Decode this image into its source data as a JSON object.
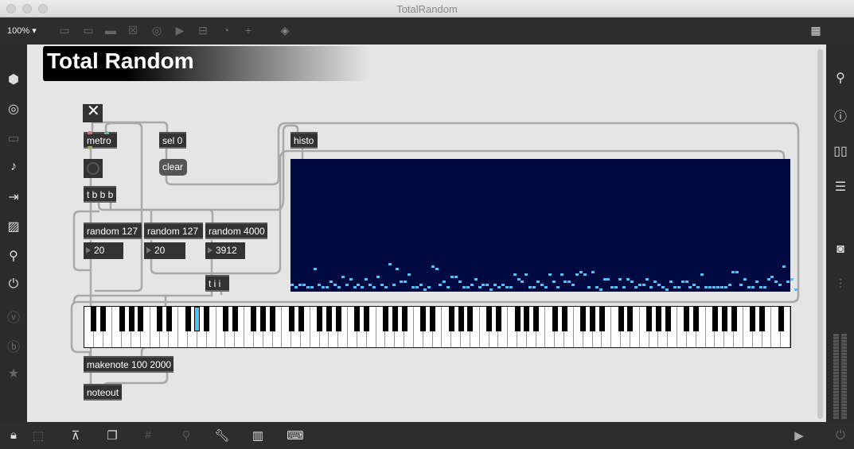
{
  "window": {
    "title": "TotalRandom"
  },
  "toolbar": {
    "zoom": "100%"
  },
  "patch": {
    "title": "Total Random",
    "objects": {
      "metro": "metro",
      "sel": "sel 0",
      "clear": "clear",
      "tbbb": "t b b b",
      "rand1": "random 127",
      "rand2": "random 127",
      "rand3": "random 4000",
      "tii": "t i i",
      "histo": "histo",
      "makenote": "makenote 100 2000",
      "noteout": "noteout"
    },
    "numbers": {
      "n1": "20",
      "n2": "20",
      "n3": "3912"
    },
    "keyboard": {
      "low_note": 0,
      "high_note": 127,
      "active_note": 20,
      "active_color": "#4fc3f7"
    },
    "histogram": {
      "bg": "#000a40",
      "color": "#4fc3f7",
      "bins": [
        2,
        1,
        2,
        2,
        1,
        1,
        8,
        2,
        1,
        1,
        3,
        2,
        1,
        5,
        2,
        4,
        1,
        2,
        1,
        4,
        2,
        1,
        5,
        2,
        1,
        10,
        2,
        8,
        3,
        3,
        6,
        1,
        1,
        2,
        0,
        1,
        9,
        8,
        2,
        3,
        1,
        5,
        5,
        3,
        1,
        1,
        2,
        4,
        1,
        2,
        2,
        0,
        2,
        1,
        2,
        1,
        1,
        6,
        4,
        3,
        6,
        1,
        1,
        3,
        2,
        1,
        6,
        3,
        1,
        6,
        3,
        3,
        2,
        6,
        7,
        6,
        1,
        7,
        1,
        0,
        4,
        4,
        1,
        1,
        4,
        1,
        4,
        3,
        1,
        2,
        2,
        4,
        1,
        3,
        2,
        1,
        0,
        3,
        1,
        1,
        3,
        3,
        1,
        2,
        1,
        6,
        1,
        1,
        1,
        1,
        1,
        1,
        2,
        7,
        7,
        2,
        4,
        1,
        1,
        3,
        1,
        1,
        4,
        5,
        3,
        2,
        9,
        3,
        4,
        0
      ]
    }
  }
}
